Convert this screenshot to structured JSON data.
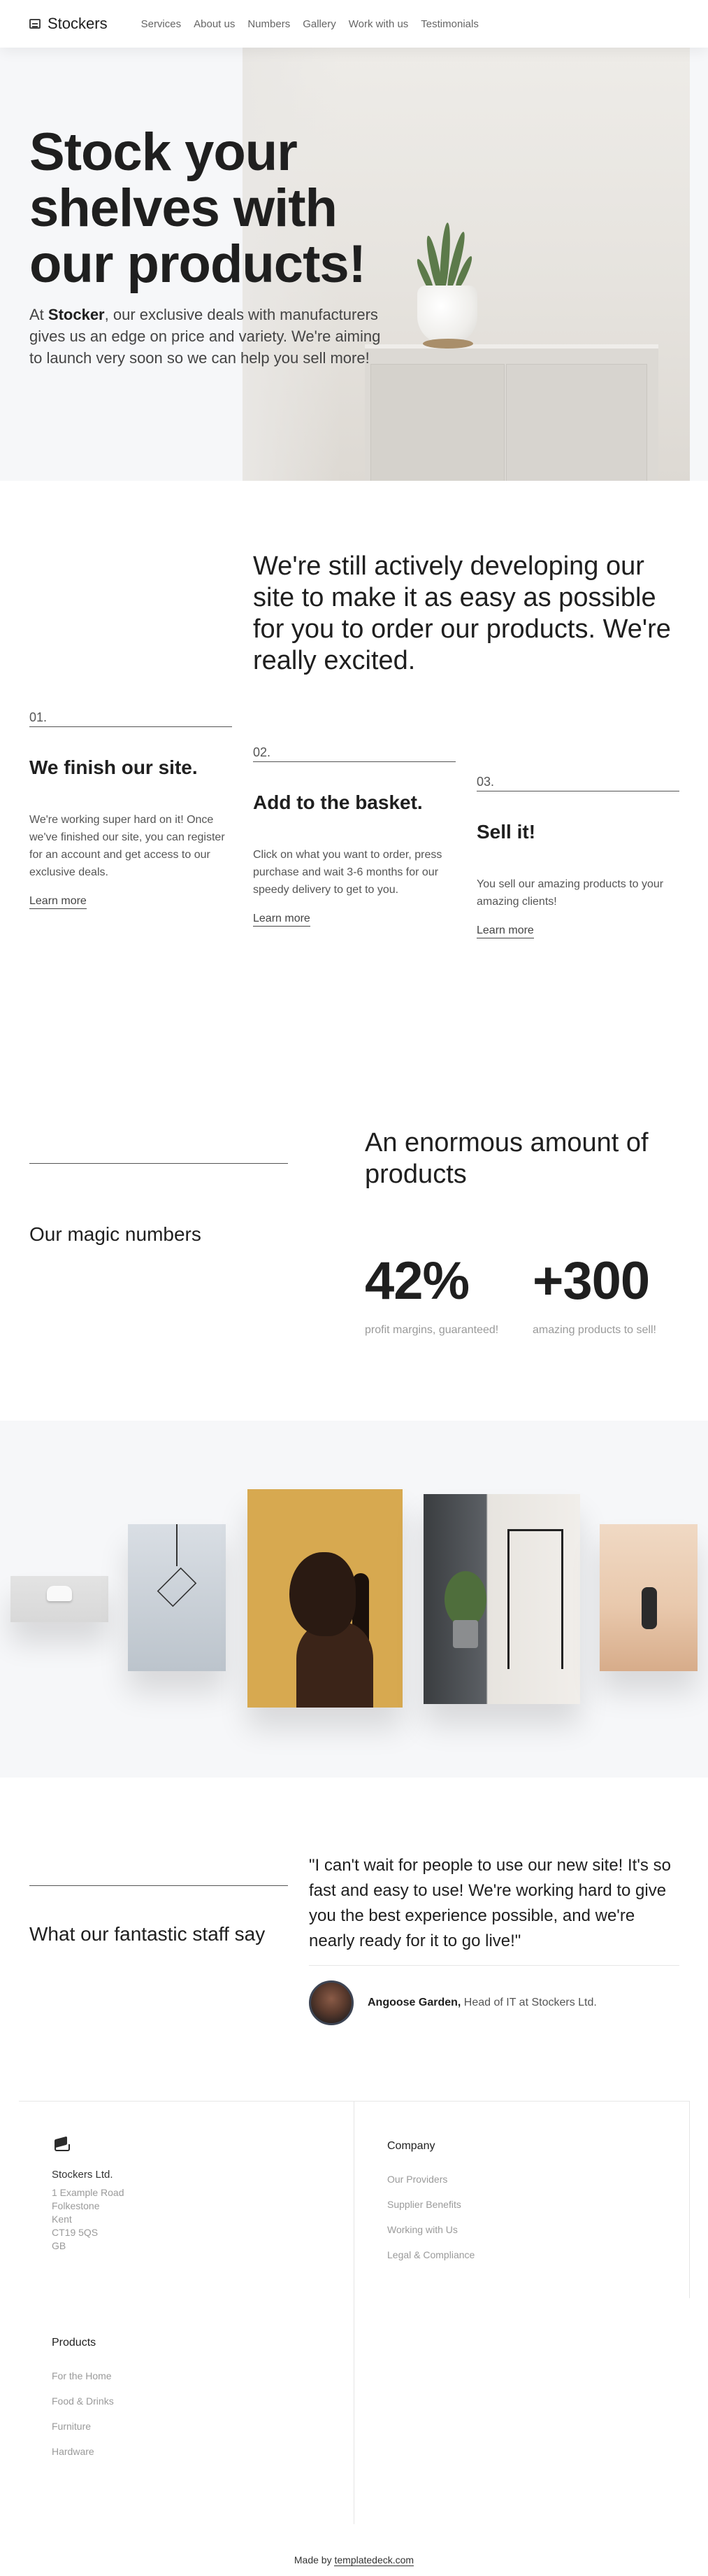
{
  "nav": {
    "brand": "Stockers",
    "links": [
      "Services",
      "About us",
      "Numbers",
      "Gallery",
      "Work with us",
      "Testimonials"
    ]
  },
  "hero": {
    "title": "Stock your shelves with our products!",
    "text_prefix": "At ",
    "text_brand": "Stocker",
    "text_rest": ", our exclusive deals with manufacturers gives us an edge on price and variety. We're aiming to launch very soon so we can help you sell more!"
  },
  "steps": {
    "intro": "We're still actively developing our site to make it as easy as possible for you to order our products. We're really excited.",
    "items": [
      {
        "num": "01.",
        "title": "We finish our site.",
        "text": "We're working super hard on it! Once we've finished our site, you can register for an account and get access to our exclusive deals.",
        "link": "Learn more"
      },
      {
        "num": "02.",
        "title": "Add to the basket.",
        "text": "Click on what you want to order, press purchase and wait 3-6 months for our speedy delivery to get to you.",
        "link": "Learn more"
      },
      {
        "num": "03.",
        "title": "Sell it!",
        "text": "You sell our amazing products to your amazing clients!",
        "link": "Learn more"
      }
    ]
  },
  "numbers": {
    "label": "Our magic numbers",
    "heading": "An enormous amount of products",
    "stats": [
      {
        "value": "42%",
        "caption": "profit margins, guaranteed!"
      },
      {
        "value": "+300",
        "caption": "amazing products to sell!"
      }
    ]
  },
  "testimonials": {
    "label": "What our fantastic staff say",
    "quote": "\"I can't wait for people to use our new site! It's so fast and easy to use! We're working hard to give you the best experience possible, and we're nearly ready for it to go live!\"",
    "author_name": "Angoose Garden,",
    "author_role": " Head of IT at Stockers Ltd."
  },
  "footer": {
    "company": "Stockers Ltd.",
    "address": [
      "1 Example Road",
      "Folkestone",
      "Kent",
      "CT19 5QS",
      "GB"
    ],
    "company_heading": "Company",
    "company_links": [
      "Our Providers",
      "Supplier Benefits",
      "Working with Us",
      "Legal & Compliance"
    ],
    "products_heading": "Products",
    "products_links": [
      "For the Home",
      "Food & Drinks",
      "Furniture",
      "Hardware"
    ],
    "made_by_prefix": "Made by ",
    "made_by_link": "templatedeck.com"
  }
}
